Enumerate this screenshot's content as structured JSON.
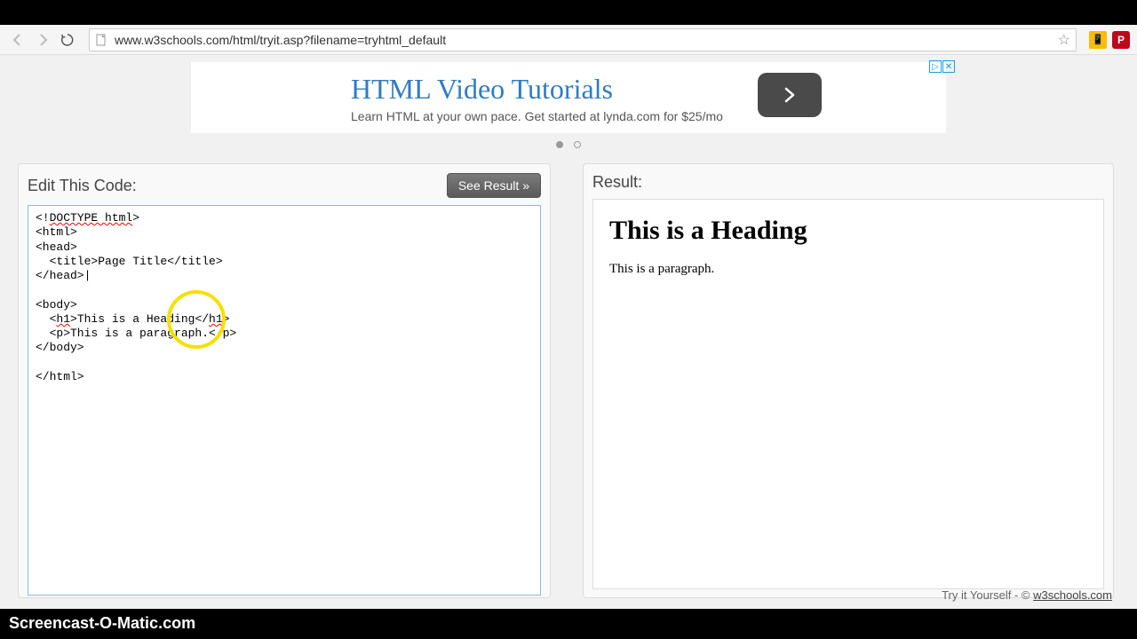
{
  "browser": {
    "url": "www.w3schools.com/html/tryit.asp?filename=tryhtml_default"
  },
  "ad": {
    "title": "HTML Video Tutorials",
    "subtitle": "Learn HTML at your own pace. Get started at lynda.com for $25/mo"
  },
  "editor": {
    "title": "Edit This Code:",
    "button": "See Result »",
    "code": {
      "l1a": "<!",
      "l1b": "DOCTYPE html",
      "l1c": ">",
      "l2": "<html>",
      "l3": "<head>",
      "l4": "  <title>Page Title</title>",
      "l5": "</head>",
      "l6": "",
      "l7": "<body>",
      "l8a": "  <",
      "l8b": "h1",
      "l8c": ">This is a Heading</",
      "l8d": "h1",
      "l8e": ">",
      "l9": "  <p>This is a paragraph.</p>",
      "l10": "</body>",
      "l11": "",
      "l12": "</html>"
    }
  },
  "result": {
    "title": "Result:",
    "heading": "This is a Heading",
    "paragraph": "This is a paragraph."
  },
  "footer": {
    "prefix": "Try it Yourself - © ",
    "link": "w3schools.com"
  },
  "watermark": "Screencast-O-Matic.com"
}
